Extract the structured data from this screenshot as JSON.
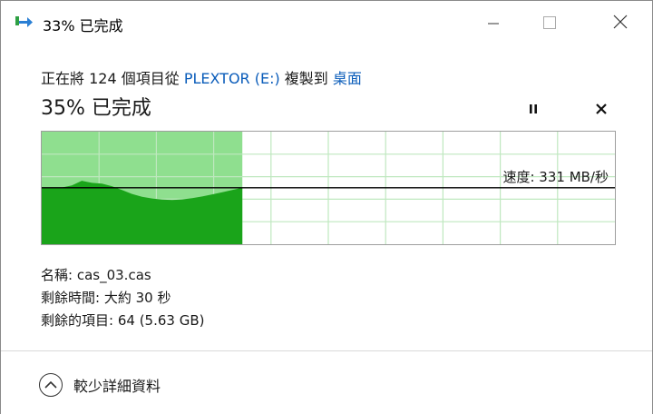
{
  "window": {
    "title": "33% 已完成",
    "icons": {
      "app": "copy-arrow-icon",
      "minimize": "minimize-icon",
      "maximize": "maximize-icon",
      "close": "close-icon"
    }
  },
  "operation": {
    "prefix": "正在將 124 個項目從 ",
    "source": "PLEXTOR (E:)",
    "middle": " 複製到 ",
    "destination": "桌面"
  },
  "progress": {
    "label": "35% 已完成",
    "fraction": 0.35,
    "pause_icon": "pause-icon",
    "cancel_icon": "cancel-icon"
  },
  "graph": {
    "speed_label": "速度: 331 MB/秒",
    "speed_mbps": 331,
    "colors": {
      "fill": "#1aa41a",
      "fill_done": "#8fdf8f",
      "grid": "#bfe8bf",
      "speed_line": "#000000",
      "border": "#9e9e9e"
    },
    "speed_history_mbps": [
      331,
      331,
      332,
      345,
      372,
      360,
      355,
      340,
      318,
      295,
      278,
      268,
      262,
      260,
      263,
      270,
      280,
      292,
      305,
      318,
      331
    ]
  },
  "details": {
    "name_label": "名稱:",
    "name_value": "cas_03.cas",
    "time_label": "剩餘時間:",
    "time_value": "大約 30 秒",
    "items_label": "剩餘的項目:",
    "items_value": "64 (5.63 GB)"
  },
  "footer": {
    "toggle_label": "較少詳細資料",
    "toggle_icon": "chevron-up-circle-icon"
  }
}
